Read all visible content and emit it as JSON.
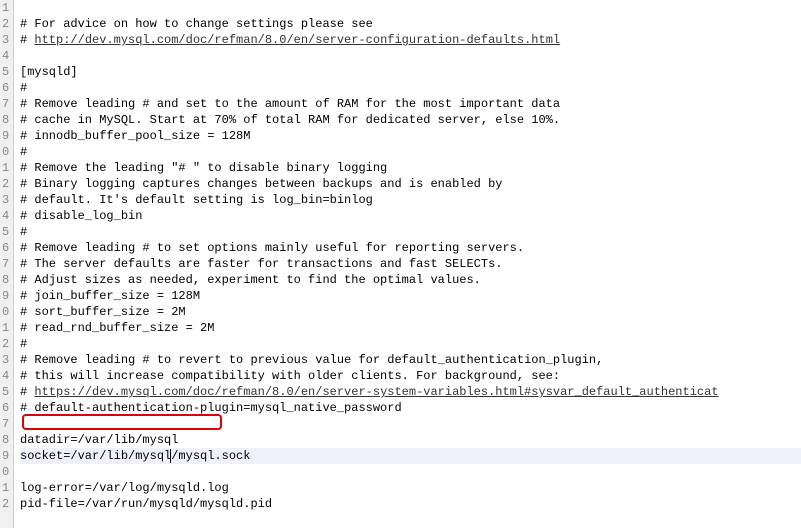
{
  "gutter": {
    "start_ones": 1,
    "wrap_at": 10,
    "count": 32
  },
  "lines": [
    {
      "type": "comment",
      "text": "# For advice on how to change settings please see"
    },
    {
      "type": "comment_link",
      "prefix": "# ",
      "href": "http://dev.mysql.com/doc/refman/8.0/en/server-configuration-defaults.html",
      "link_text": "http://dev.mysql.com/doc/refman/8.0/en/server-configuration-defaults.html"
    },
    {
      "type": "blank",
      "text": ""
    },
    {
      "type": "plain",
      "text": "[mysqld]"
    },
    {
      "type": "comment",
      "text": "#"
    },
    {
      "type": "comment",
      "text": "# Remove leading # and set to the amount of RAM for the most important data"
    },
    {
      "type": "comment",
      "text": "# cache in MySQL. Start at 70% of total RAM for dedicated server, else 10%."
    },
    {
      "type": "comment",
      "text": "# innodb_buffer_pool_size = 128M"
    },
    {
      "type": "comment",
      "text": "#"
    },
    {
      "type": "comment",
      "text": "# Remove the leading \"# \" to disable binary logging"
    },
    {
      "type": "comment",
      "text": "# Binary logging captures changes between backups and is enabled by"
    },
    {
      "type": "comment",
      "text": "# default. It's default setting is log_bin=binlog"
    },
    {
      "type": "comment",
      "text": "# disable_log_bin"
    },
    {
      "type": "comment",
      "text": "#"
    },
    {
      "type": "comment",
      "text": "# Remove leading # to set options mainly useful for reporting servers."
    },
    {
      "type": "comment",
      "text": "# The server defaults are faster for transactions and fast SELECTs."
    },
    {
      "type": "comment",
      "text": "# Adjust sizes as needed, experiment to find the optimal values."
    },
    {
      "type": "comment",
      "text": "# join_buffer_size = 128M"
    },
    {
      "type": "comment",
      "text": "# sort_buffer_size = 2M"
    },
    {
      "type": "comment",
      "text": "# read_rnd_buffer_size = 2M"
    },
    {
      "type": "comment",
      "text": "#"
    },
    {
      "type": "comment",
      "text": "# Remove leading # to revert to previous value for default_authentication_plugin,"
    },
    {
      "type": "comment",
      "text": "# this will increase compatibility with older clients. For background, see:"
    },
    {
      "type": "comment_link",
      "prefix": "# ",
      "href": "https://dev.mysql.com/doc/refman/8.0/en/server-system-variables.html#sysvar_default_authenticat",
      "link_text": "https://dev.mysql.com/doc/refman/8.0/en/server-system-variables.html#sysvar_default_authenticat"
    },
    {
      "type": "comment",
      "text": "# default-authentication-plugin=mysql_native_password"
    },
    {
      "type": "blank",
      "text": ""
    },
    {
      "type": "plain",
      "text": "datadir=/var/lib/mysql"
    },
    {
      "type": "current",
      "pre": "socket=/var/lib/mysql",
      "post": "/mysql.sock"
    },
    {
      "type": "blank",
      "text": ""
    },
    {
      "type": "plain",
      "text": "log-error=/var/log/mysqld.log"
    },
    {
      "type": "plain",
      "text": "pid-file=/var/run/mysqld/mysqld.pid"
    },
    {
      "type": "blank",
      "text": ""
    }
  ],
  "highlight": {
    "box_start_line": 26,
    "box_end_line": 27
  }
}
